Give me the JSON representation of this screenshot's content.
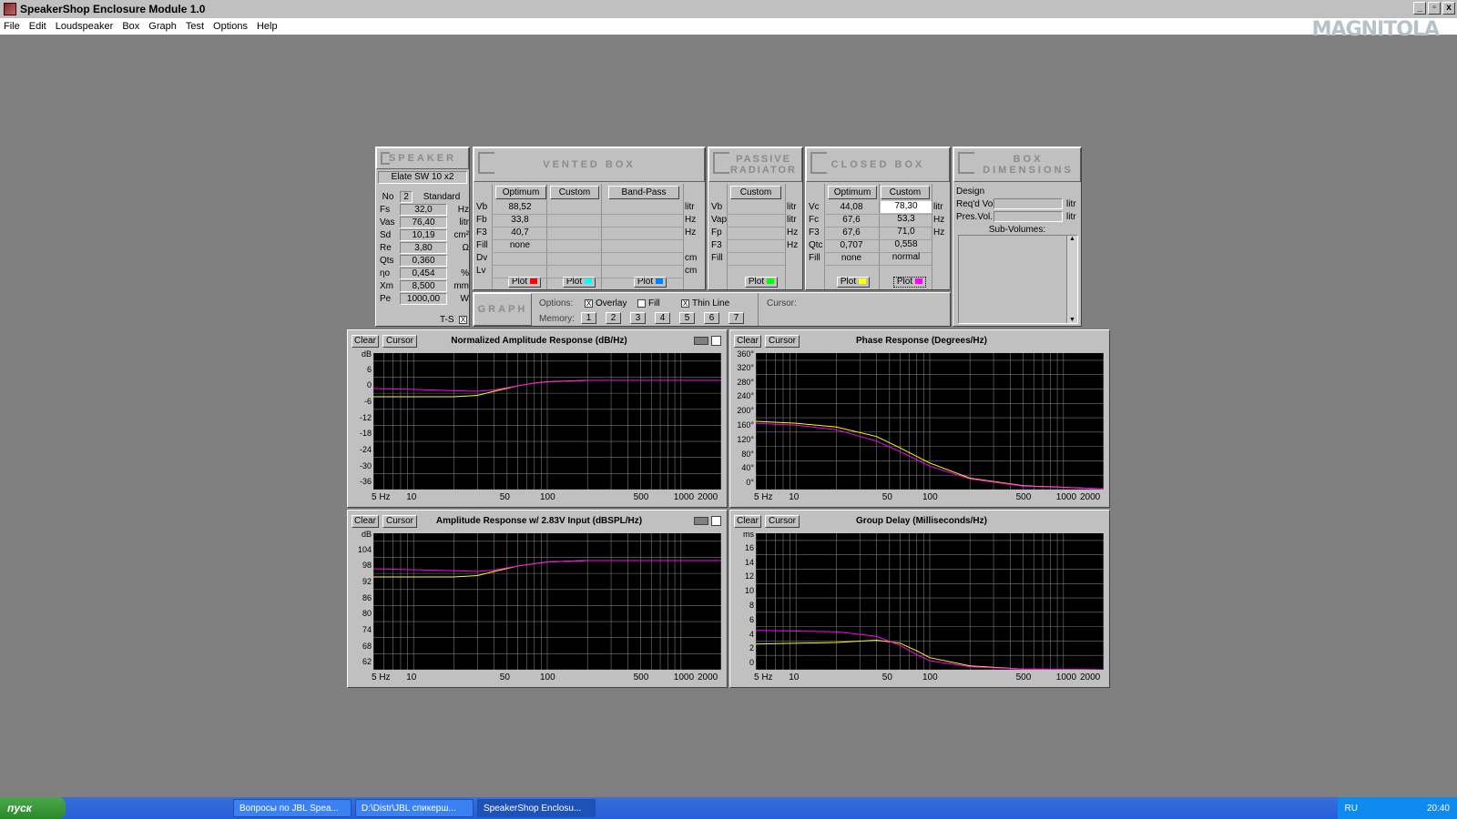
{
  "window": {
    "title": "SpeakerShop Enclosure Module 1.0",
    "minimize": "_",
    "restore": "▫",
    "close": "x"
  },
  "menu": [
    "File",
    "Edit",
    "Loudspeaker",
    "Box",
    "Graph",
    "Test",
    "Options",
    "Help"
  ],
  "watermark": "MAGNITOLA",
  "speaker": {
    "header": "SPEAKER",
    "name": "Elate SW 10 x2",
    "no_label": "No",
    "no_value": "2",
    "mode": "Standard",
    "rows": [
      [
        "Fs",
        "32,0",
        "Hz"
      ],
      [
        "Vas",
        "76,40",
        "litr"
      ],
      [
        "Sd",
        "10,19",
        "cm²"
      ],
      [
        "Re",
        "3,80",
        "Ω"
      ],
      [
        "Qts",
        "0,360",
        ""
      ],
      [
        "ηo",
        "0,454",
        "%"
      ],
      [
        "Xm",
        "8,500",
        "mm"
      ],
      [
        "Pe",
        "1000,00",
        "W"
      ]
    ],
    "ts_label": "T-S",
    "ts_check": "X"
  },
  "vented": {
    "header": "VENTED BOX",
    "optimum": "Optimum",
    "custom": "Custom",
    "bandpass": "Band-Pass",
    "rows": [
      [
        "Vb",
        "88,52",
        "",
        "",
        "litr"
      ],
      [
        "Fb",
        "33,8",
        "",
        "",
        "Hz"
      ],
      [
        "F3",
        "40,7",
        "",
        "",
        "Hz"
      ],
      [
        "Fill",
        "none",
        "",
        "",
        ""
      ],
      [
        "Dv",
        "",
        "",
        "",
        "cm"
      ],
      [
        "Lv",
        "",
        "",
        "",
        "cm"
      ]
    ],
    "plot": "Plot"
  },
  "passive": {
    "header": "PASSIVE RADIATOR",
    "custom": "Custom",
    "rows": [
      [
        "Vb",
        "litr"
      ],
      [
        "Vap",
        "litr"
      ],
      [
        "Fp",
        "Hz"
      ],
      [
        "F3",
        "Hz"
      ],
      [
        "Fill",
        ""
      ]
    ],
    "plot": "Plot"
  },
  "closed": {
    "header": "CLOSED BOX",
    "optimum": "Optimum",
    "custom": "Custom",
    "rows": [
      [
        "Vc",
        "44,08",
        "78,30",
        "litr"
      ],
      [
        "Fc",
        "67,6",
        "53,3",
        "Hz"
      ],
      [
        "F3",
        "67,6",
        "71,0",
        "Hz"
      ],
      [
        "Qtc",
        "0,707",
        "0,558",
        ""
      ],
      [
        "Fill",
        "none",
        "normal",
        ""
      ]
    ],
    "plot": "Plot"
  },
  "boxdim": {
    "header": "BOX DIMENSIONS",
    "design": "Design",
    "reqd": "Req'd Vol.",
    "pres": "Pres.Vol.",
    "unit": "litr",
    "subvol": "Sub-Volumes:"
  },
  "graph": {
    "header": "GRAPH",
    "options_label": "Options:",
    "overlay": "Overlay",
    "fill": "Fill",
    "thin": "Thin Line",
    "check": "X",
    "memory_label": "Memory:",
    "memory": [
      "1",
      "2",
      "3",
      "4",
      "5",
      "6",
      "7"
    ],
    "cursor_label": "Cursor:"
  },
  "graphs": [
    {
      "title": "Normalized Amplitude Response (dB/Hz)",
      "unit": "dB",
      "yticks": [
        "6",
        "0",
        "-6",
        "-12",
        "-18",
        "-24",
        "-30",
        "-36"
      ]
    },
    {
      "title": "Phase Response (Degrees/Hz)",
      "unit": "360°",
      "yticks": [
        "320°",
        "280°",
        "240°",
        "200°",
        "160°",
        "120°",
        "80°",
        "40°",
        "0°"
      ]
    },
    {
      "title": "Amplitude Response w/ 2.83V Input (dBSPL/Hz)",
      "unit": "dB",
      "yticks": [
        "104",
        "98",
        "92",
        "86",
        "80",
        "74",
        "68",
        "62"
      ]
    },
    {
      "title": "Group Delay (Milliseconds/Hz)",
      "unit": "ms",
      "yticks": [
        "16",
        "14",
        "12",
        "10",
        "8",
        "6",
        "4",
        "2",
        "0"
      ]
    }
  ],
  "xticks": [
    "5 Hz",
    "10",
    "50",
    "100",
    "500",
    "1000",
    "2000"
  ],
  "clear": "Clear",
  "cursor": "Cursor",
  "colors": {
    "vented_opt": "#ff0000",
    "vented_custom": "#00ffff",
    "bandpass": "#0080ff",
    "passive": "#00ff00",
    "closed_opt": "#ffff00",
    "closed_custom": "#ff00ff"
  },
  "taskbar": {
    "start": "пуск",
    "tasks": [
      "Вопросы по JBL Spea...",
      "D:\\Distr\\JBL спикерш...",
      "SpeakerShop Enclosu..."
    ],
    "lang": "RU",
    "time": "20:40"
  }
}
